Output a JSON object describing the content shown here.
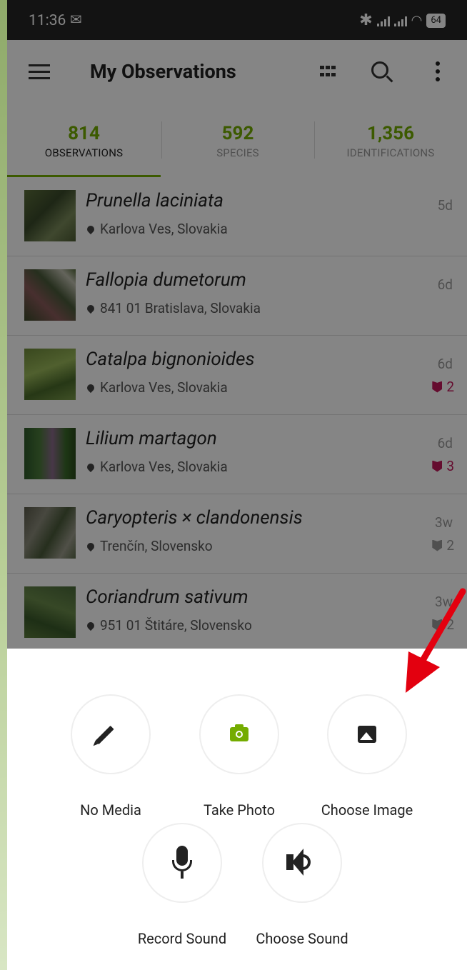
{
  "status_bar": {
    "time": "11:36",
    "battery": "64"
  },
  "app_bar": {
    "title": "My Observations"
  },
  "tabs": [
    {
      "count": "814",
      "label": "OBSERVATIONS"
    },
    {
      "count": "592",
      "label": "SPECIES"
    },
    {
      "count": "1,356",
      "label": "IDENTIFICATIONS"
    }
  ],
  "observations": [
    {
      "species": "Prunella laciniata",
      "location": "Karlova Ves, Slovakia",
      "age": "5d",
      "ids": ""
    },
    {
      "species": "Fallopia dumetorum",
      "location": "841 01 Bratislava, Slovakia",
      "age": "6d",
      "ids": ""
    },
    {
      "species": "Catalpa bignonioides",
      "location": "Karlova Ves, Slovakia",
      "age": "6d",
      "ids": "2"
    },
    {
      "species": "Lilium martagon",
      "location": "Karlova Ves, Slovakia",
      "age": "6d",
      "ids": "3"
    },
    {
      "species": "Caryopteris × clandonensis",
      "location": "Trenčín, Slovensko",
      "age": "3w",
      "ids": "2"
    },
    {
      "species": "Coriandrum sativum",
      "location": "951 01 Štitáre, Slovensko",
      "age": "3w",
      "ids": "2"
    }
  ],
  "sheet": {
    "no_media": "No Media",
    "take_photo": "Take Photo",
    "choose_image": "Choose Image",
    "record_sound": "Record Sound",
    "choose_sound": "Choose Sound"
  },
  "colors": {
    "accent": "#74ac00",
    "identification_pink": "#c2185b",
    "annotation_arrow": "#e3000f"
  }
}
